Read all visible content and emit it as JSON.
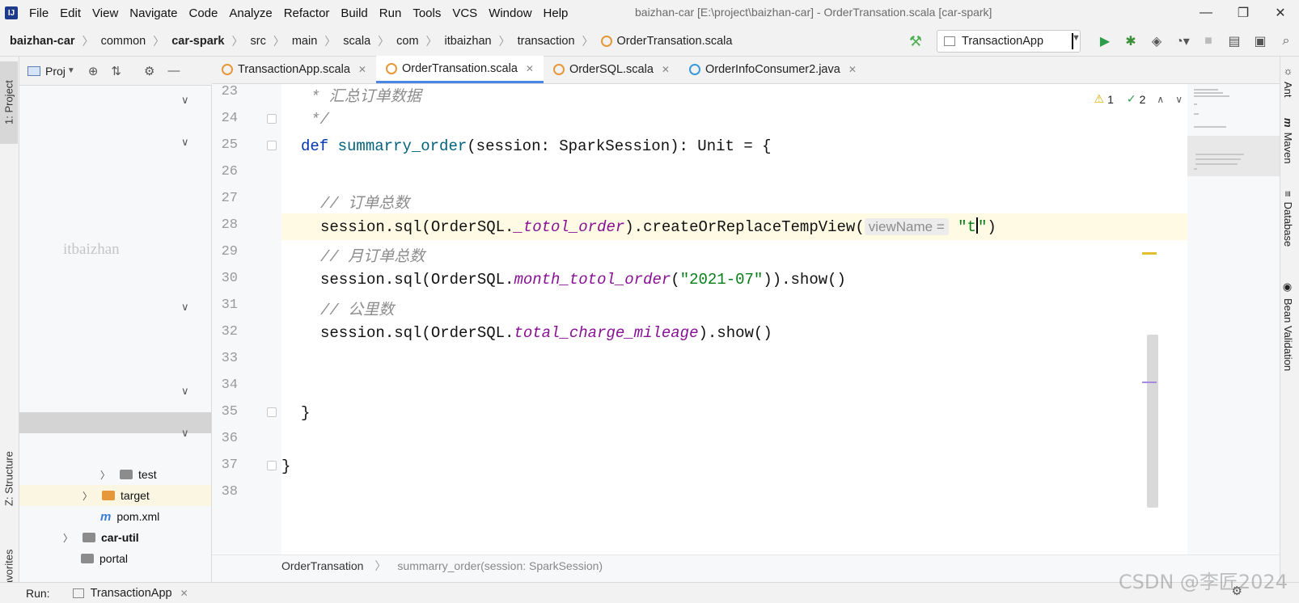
{
  "menubar": {
    "items": [
      "File",
      "Edit",
      "View",
      "Navigate",
      "Code",
      "Analyze",
      "Refactor",
      "Build",
      "Run",
      "Tools",
      "VCS",
      "Window",
      "Help"
    ],
    "window_title": "baizhan-car [E:\\project\\baizhan-car] - OrderTransation.scala [car-spark]",
    "minimize": "—",
    "restore": "❐",
    "close": "✕"
  },
  "breadcrumb": [
    "baizhan-car",
    "common",
    "car-spark",
    "src",
    "main",
    "scala",
    "com",
    "itbaizhan",
    "transaction",
    "OrderTransation.scala"
  ],
  "run_config": "TransactionApp",
  "project_panel": {
    "title": "Proj",
    "watermark": "itbaizhan",
    "tree": {
      "test": "test",
      "target": "target",
      "pom": "pom.xml",
      "car_util": "car-util",
      "portal": "portal"
    }
  },
  "left_stripe": {
    "project": "1: Project",
    "structure": "Z: Structure",
    "favorites": "Favorites"
  },
  "right_stripe": {
    "ant": "Ant",
    "maven": "Maven",
    "database": "Database",
    "bean": "Bean Validation"
  },
  "tabs": [
    {
      "label": "TransactionApp.scala",
      "type": "scala"
    },
    {
      "label": "OrderTransation.scala",
      "type": "scala"
    },
    {
      "label": "OrderSQL.scala",
      "type": "scala"
    },
    {
      "label": "OrderInfoConsumer2.java",
      "type": "java"
    }
  ],
  "inspections": {
    "warnings": "1",
    "checks": "2"
  },
  "line_numbers": [
    "23",
    "24",
    "25",
    "26",
    "27",
    "28",
    "29",
    "30",
    "31",
    "32",
    "33",
    "34",
    "35",
    "36",
    "37",
    "38"
  ],
  "code": {
    "l23": "* 汇总订单数据",
    "l24": "*/",
    "l25_kw": "def",
    "l25_fn": "summarry_order",
    "l25_rest": "(session: SparkSession): Unit = {",
    "l27": "// 订单总数",
    "l28_a": "session.sql(OrderSQL.",
    "l28_b": "_totol_order",
    "l28_c": ").createOrReplaceTempView(",
    "l28_hint": "viewName =",
    "l28_str_a": "\"t",
    "l28_str_b": "\"",
    "l28_end": ")",
    "l29": "// 月订单总数",
    "l30_a": "session.sql(OrderSQL.",
    "l30_b": "month_totol_order",
    "l30_c": "(",
    "l30_str": "\"2021-07\"",
    "l30_d": ")).show()",
    "l31": "// 公里数",
    "l32_a": "session.sql(OrderSQL.",
    "l32_b": "total_charge_mileage",
    "l32_c": ").show()",
    "l35": "}",
    "l37": "}"
  },
  "bottom_breadcrumb": {
    "class": "OrderTransation",
    "method": "summarry_order(session: SparkSession)"
  },
  "runbar": {
    "label": "Run:",
    "tab": "TransactionApp"
  },
  "watermark_csdn": "CSDN @李匠2024"
}
